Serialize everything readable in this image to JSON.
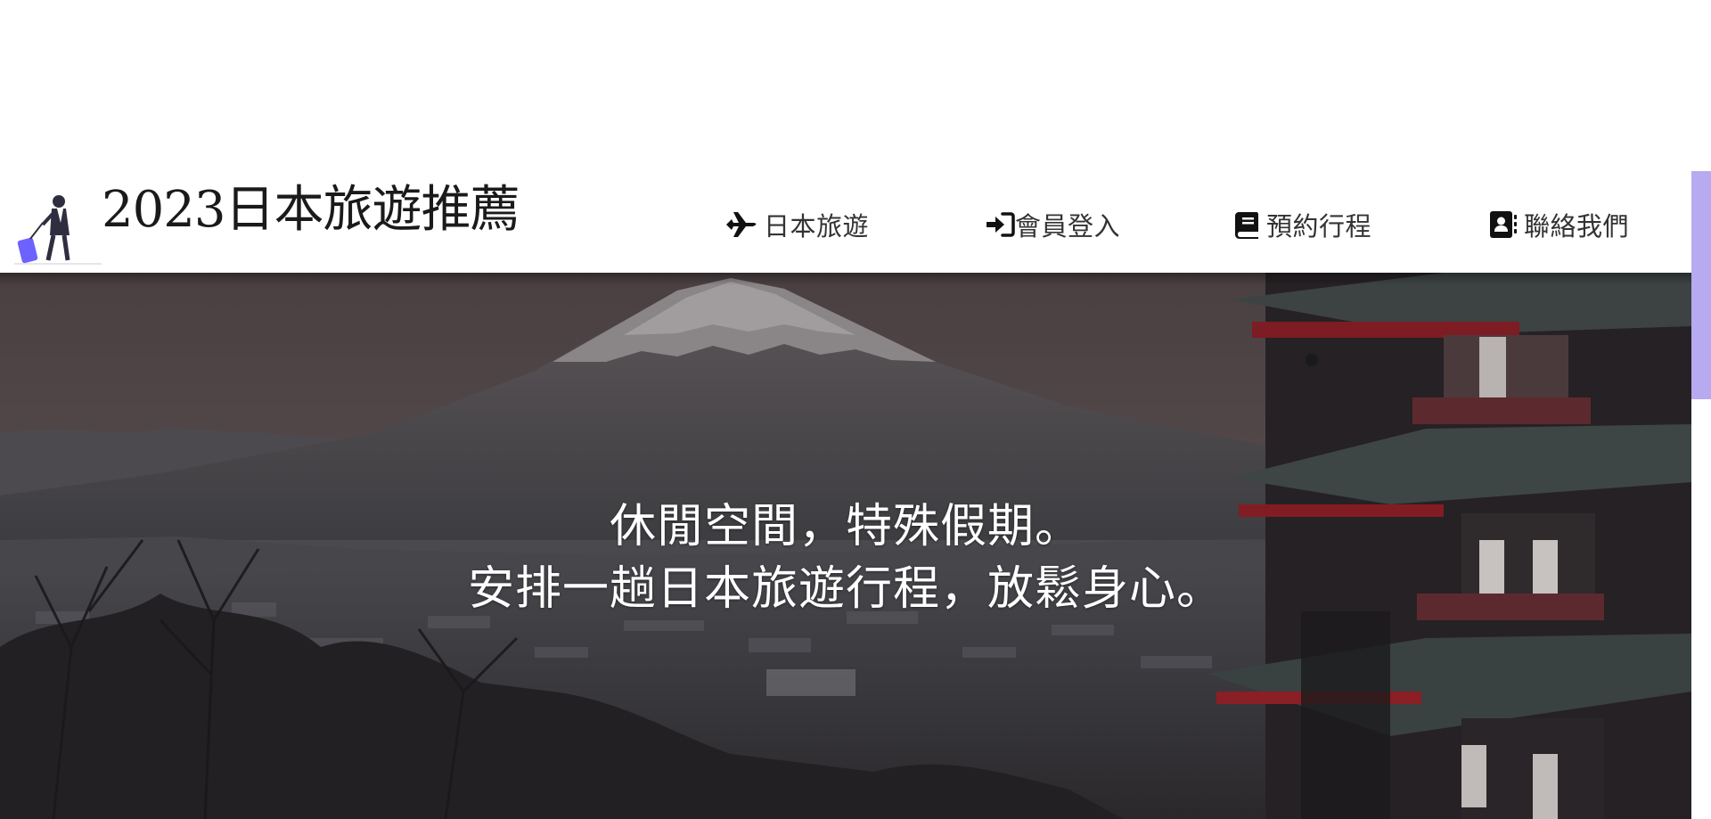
{
  "header": {
    "title": "2023日本旅遊推薦",
    "logo_icon": "traveler-with-suitcase-icon"
  },
  "nav": [
    {
      "label": "日本旅遊",
      "icon": "airplane-icon"
    },
    {
      "label": "會員登入",
      "icon": "sign-in-icon"
    },
    {
      "label": "預約行程",
      "icon": "book-icon"
    },
    {
      "label": "聯絡我們",
      "icon": "address-book-icon"
    }
  ],
  "hero": {
    "line1": "休閒空間，特殊假期。",
    "line2": "安排一趟日本旅遊行程，放鬆身心。"
  },
  "colors": {
    "nav_text": "#333333",
    "title_text": "#1a1a1a",
    "scrollbar_thumb": "#b8aaf0",
    "hero_text": "#ffffff",
    "pagoda_red": "#8a1f25"
  }
}
